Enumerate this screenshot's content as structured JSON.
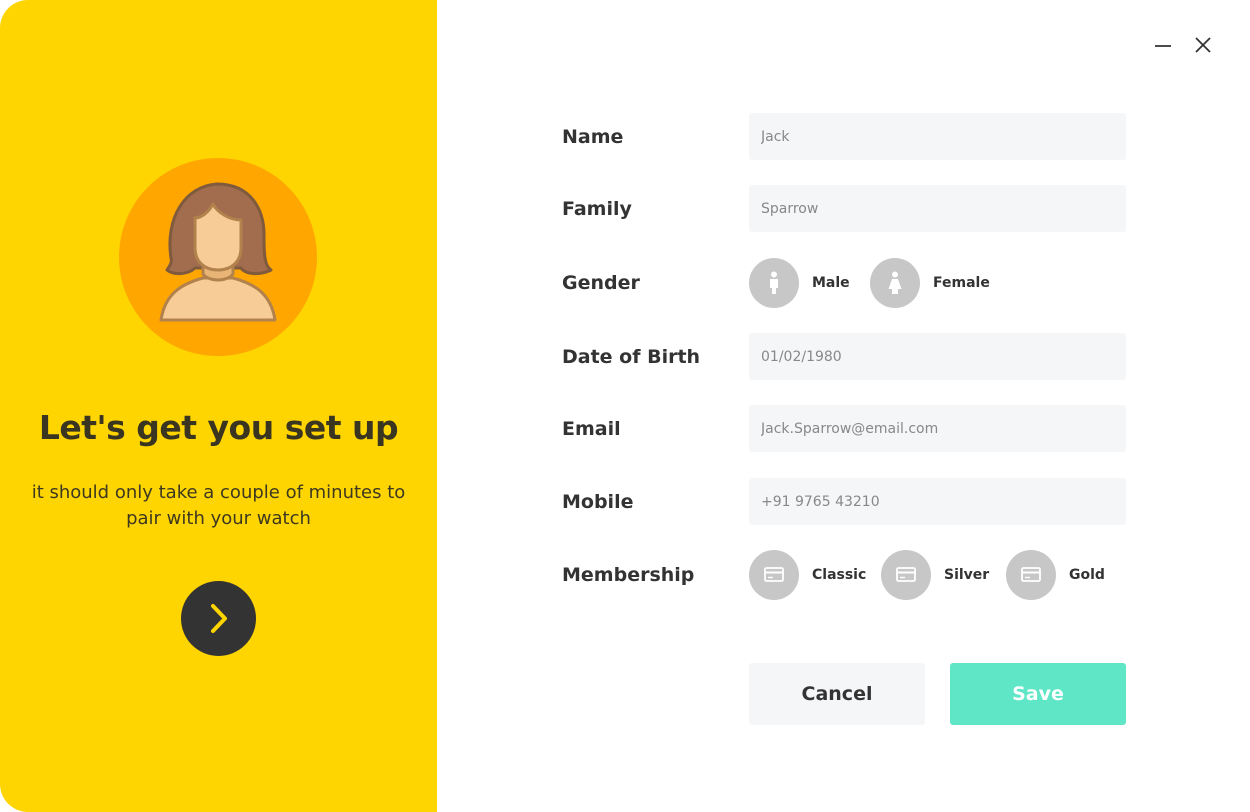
{
  "window": {
    "minimize_icon": "minimize-icon",
    "close_icon": "close-icon"
  },
  "hero": {
    "title": "Let's get you set up",
    "subtitle": "it should only take a couple of minutes to pair with your watch",
    "avatar_icon": "user-avatar-icon",
    "next_icon": "chevron-right-icon"
  },
  "form": {
    "name": {
      "label": "Name",
      "placeholder": "Jack"
    },
    "family": {
      "label": "Family",
      "placeholder": "Sparrow"
    },
    "gender": {
      "label": "Gender",
      "options": [
        {
          "label": "Male",
          "icon": "male-icon"
        },
        {
          "label": "Female",
          "icon": "female-icon"
        }
      ]
    },
    "dob": {
      "label": "Date of Birth",
      "placeholder": "01/02/1980"
    },
    "email": {
      "label": "Email",
      "placeholder": "Jack.Sparrow@email.com"
    },
    "mobile": {
      "label": "Mobile",
      "placeholder": "+91 9765 43210"
    },
    "membership": {
      "label": "Membership",
      "options": [
        {
          "label": "Classic",
          "icon": "card-icon"
        },
        {
          "label": "Silver",
          "icon": "card-icon"
        },
        {
          "label": "Gold",
          "icon": "card-icon"
        }
      ]
    }
  },
  "actions": {
    "cancel_label": "Cancel",
    "save_label": "Save"
  },
  "colors": {
    "left_panel": "#FED500",
    "avatar_bg": "#FFA600",
    "next_button": "#333333",
    "input_bg": "#F5F6F8",
    "option_circle": "#C7C7C7",
    "save_button": "#5EE6C6",
    "text_dark": "#333333"
  }
}
